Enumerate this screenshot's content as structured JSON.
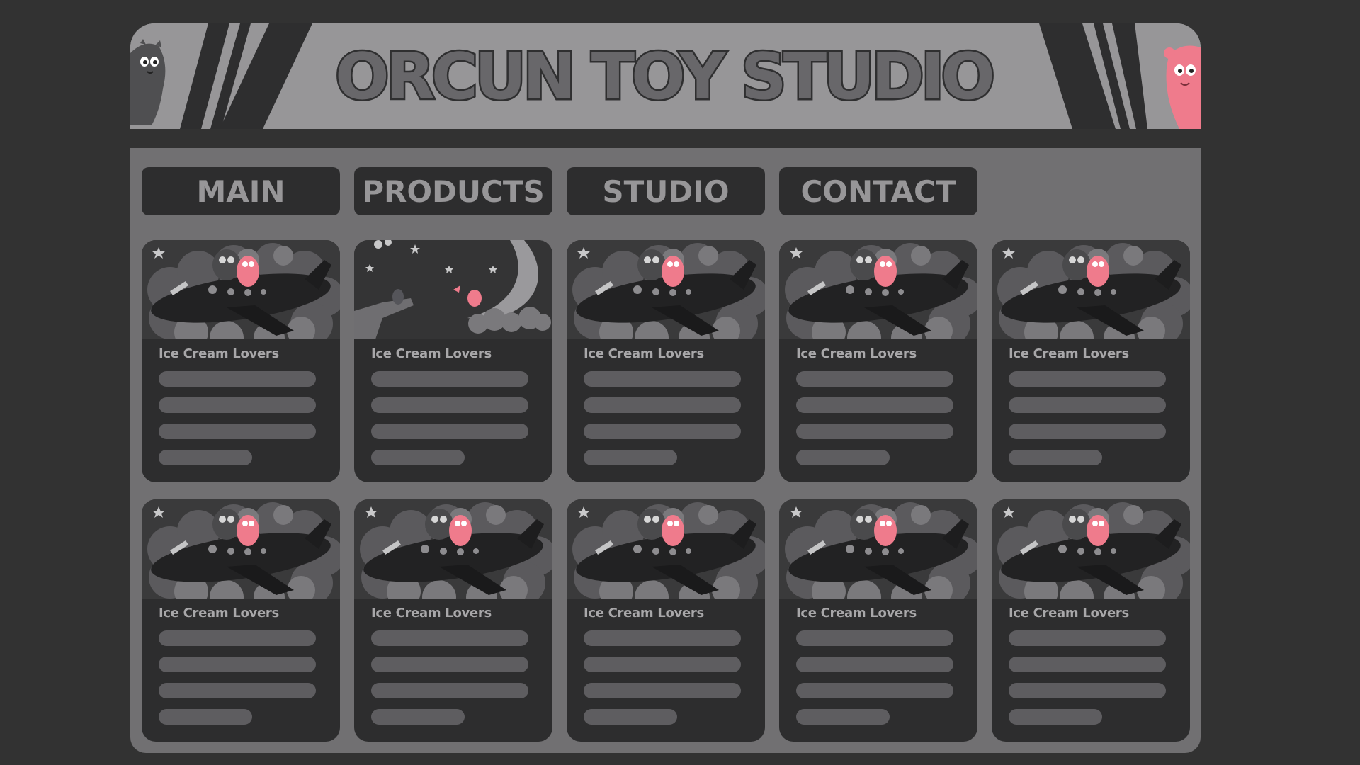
{
  "header": {
    "title": "ORCUN TOY STUDIO",
    "left_mascot": "gray-monster-icon",
    "right_mascot": "pink-monster-icon"
  },
  "nav": {
    "items": [
      {
        "label": "MAIN"
      },
      {
        "label": "PRODUCTS"
      },
      {
        "label": "STUDIO"
      },
      {
        "label": "CONTACT"
      }
    ]
  },
  "cards": [
    {
      "title": "Ice Cream Lovers",
      "image": "airplane-monsters-illustration"
    },
    {
      "title": "Ice Cream Lovers",
      "image": "moon-night-illustration"
    },
    {
      "title": "Ice Cream Lovers",
      "image": "airplane-monsters-illustration"
    },
    {
      "title": "Ice Cream Lovers",
      "image": "airplane-monsters-illustration"
    },
    {
      "title": "Ice Cream Lovers",
      "image": "airplane-monsters-illustration"
    },
    {
      "title": "Ice Cream Lovers",
      "image": "airplane-monsters-illustration"
    },
    {
      "title": "Ice Cream Lovers",
      "image": "airplane-monsters-illustration"
    },
    {
      "title": "Ice Cream Lovers",
      "image": "airplane-monsters-illustration"
    },
    {
      "title": "Ice Cream Lovers",
      "image": "airplane-monsters-illustration"
    },
    {
      "title": "Ice Cream Lovers",
      "image": "airplane-monsters-illustration"
    }
  ],
  "colors": {
    "background": "#323232",
    "header": "#979698",
    "panel": "#717072",
    "card": "#2d2d2e",
    "accent_pink": "#ef7b8c"
  }
}
